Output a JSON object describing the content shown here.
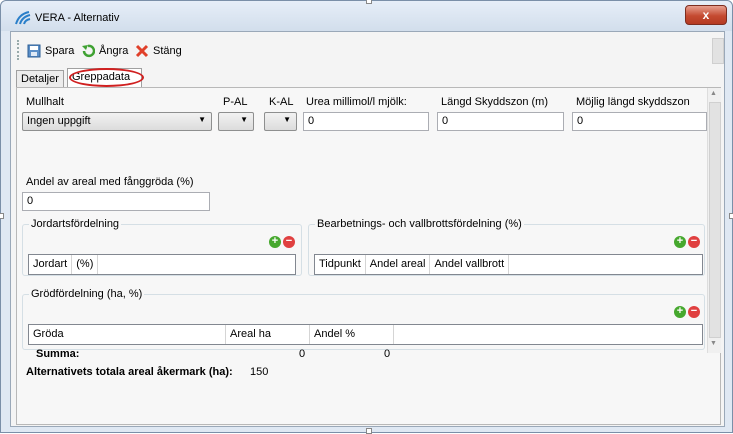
{
  "window": {
    "title": "VERA - Alternativ",
    "close_label": "x"
  },
  "toolbar": {
    "save_label": "Spara",
    "undo_label": "Ångra",
    "close_label": "Stäng"
  },
  "tabs": [
    {
      "label": "Detaljer",
      "active": false
    },
    {
      "label": "Greppadata",
      "active": true
    }
  ],
  "form": {
    "mullhalt": {
      "label": "Mullhalt",
      "value": "Ingen uppgift"
    },
    "pal": {
      "label": "P-AL",
      "value": ""
    },
    "kal": {
      "label": "K-AL",
      "value": ""
    },
    "urea": {
      "label": "Urea millimol/l mjölk:",
      "value": "0"
    },
    "langd_skyddszon": {
      "label": "Längd Skyddszon (m)",
      "value": "0"
    },
    "mojlig_langd": {
      "label": "Möjlig längd skyddszon",
      "value": "0"
    },
    "andel_fanggroda": {
      "label": "Andel av areal med fånggröda (%)",
      "value": "0"
    }
  },
  "jordarts": {
    "title": "Jordartsfördelning",
    "columns": [
      "Jordart",
      "(%)"
    ]
  },
  "bearbetning": {
    "title": "Bearbetnings- och vallbrottsfördelning (%)",
    "columns": [
      "Tidpunkt",
      "Andel areal",
      "Andel vallbrott"
    ]
  },
  "grodfordelning": {
    "title": "Grödfördelning (ha, %)",
    "columns": [
      "Gröda",
      "Areal ha",
      "Andel %"
    ],
    "summa_label": "Summa:",
    "summa_areal": "0",
    "summa_andel": "0"
  },
  "total": {
    "label": "Alternativets totala areal åkermark (ha):",
    "value": "150"
  },
  "colors": {
    "plus": "#46a82e",
    "minus": "#e04040",
    "close": "#c44a30",
    "highlight": "#d02020"
  }
}
